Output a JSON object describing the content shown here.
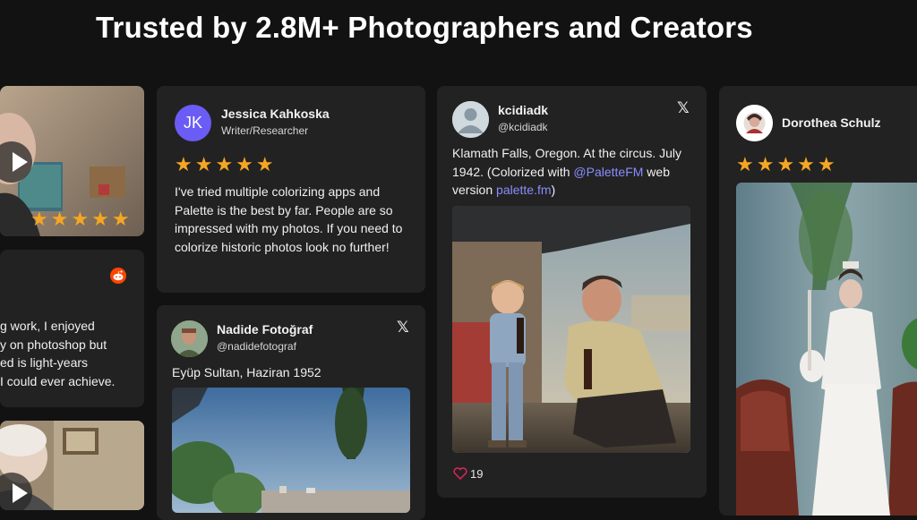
{
  "page": {
    "title": "Trusted by 2.8M+ Photographers and Creators"
  },
  "colors": {
    "background": "#121212",
    "card": "#222222",
    "star": "#f5a623",
    "link": "#8a8cff",
    "reddit": "#ff4500"
  },
  "cards": {
    "left_video_1": {
      "stars": "★★★★★"
    },
    "left_reddit": {
      "lines": [
        "g work, I enjoyed",
        "y on photoshop but",
        "ed is light-years",
        "I could ever achieve."
      ]
    },
    "jessica": {
      "initials": "JK",
      "name": "Jessica Kahkoska",
      "role": "Writer/Researcher",
      "stars": "★★★★★",
      "text": "I've tried multiple colorizing apps and Palette is the best by far. People are so impressed with my photos. If you need to colorize historic photos look no further!"
    },
    "nadide": {
      "name": "Nadide Fotoğraf",
      "handle": "@nadidefotograf",
      "text": "Eyüp Sultan, Haziran 1952",
      "x_glyph": "𝕏"
    },
    "kcidiadk": {
      "name": "kcidiadk",
      "handle": "@kcidiadk",
      "text_part1": "Klamath Falls, Oregon. At the circus. July 1942. (Colorized with ",
      "mention": "@PaletteFM",
      "text_part2": " web version ",
      "url": "palette.fm",
      "text_part3": ")",
      "likes": "19",
      "x_glyph": "𝕏"
    },
    "dorothea": {
      "name": "Dorothea Schulz",
      "stars": "★★★★★"
    }
  }
}
